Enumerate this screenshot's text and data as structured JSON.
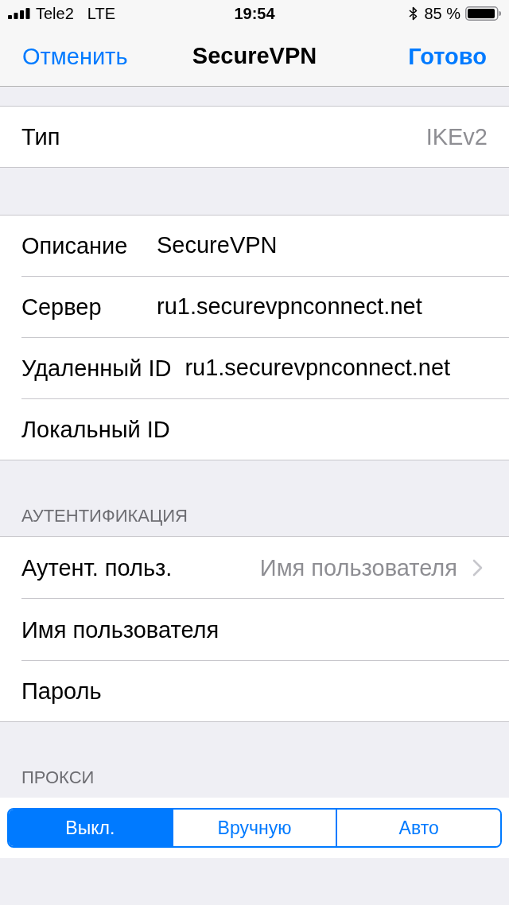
{
  "status_bar": {
    "carrier": "Tele2",
    "network": "LTE",
    "time": "19:54",
    "battery": "85 %"
  },
  "nav_bar": {
    "cancel": "Отменить",
    "title": "SecureVPN",
    "done": "Готово"
  },
  "sections": [
    {
      "rows": [
        {
          "kind": "detail",
          "label": "Тип",
          "value": "IKEv2"
        }
      ]
    },
    {
      "rows": [
        {
          "kind": "field",
          "label": "Описание",
          "value": "SecureVPN"
        },
        {
          "kind": "field",
          "label": "Сервер",
          "value": "ru1.securevpnconnect.net"
        },
        {
          "kind": "field",
          "label": "Удаленный ID",
          "value": "ru1.securevpnconnect.net"
        },
        {
          "kind": "field",
          "label": "Локальный ID"
        }
      ]
    },
    {
      "header": "АУТЕНТИФИКАЦИЯ",
      "rows": [
        {
          "kind": "disclosure",
          "label": "Аутент. польз.",
          "value": "Имя пользователя"
        },
        {
          "kind": "field",
          "label": "Имя пользователя"
        },
        {
          "kind": "field",
          "label": "Пароль"
        }
      ]
    },
    {
      "header": "ПРОКСИ",
      "segments": [
        {
          "label": "Выкл.",
          "selected": true
        },
        {
          "label": "Вручную",
          "selected": false
        },
        {
          "label": "Авто",
          "selected": false
        }
      ]
    }
  ]
}
